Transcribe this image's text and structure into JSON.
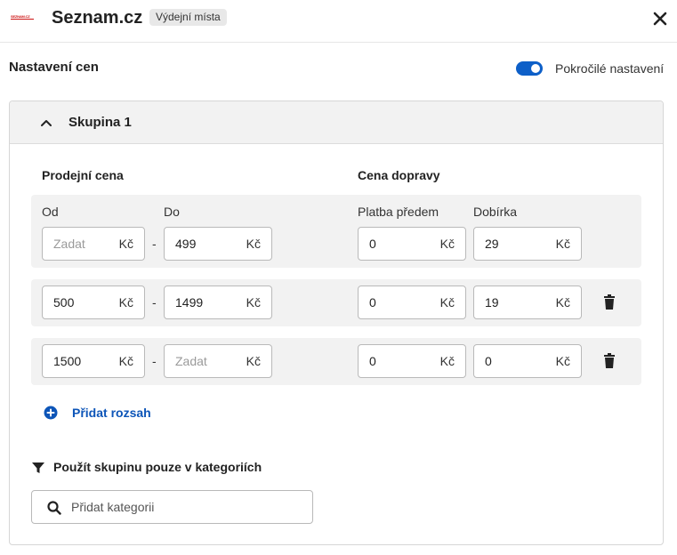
{
  "header": {
    "logo_text": "SEZNAM.CZ",
    "title": "Seznam.cz",
    "badge": "Výdejní místa",
    "close_icon": "close-icon"
  },
  "settings": {
    "title": "Nastavení cen",
    "toggle_label": "Pokročilé nastavení",
    "toggle_on": true,
    "accent_color": "#0d5fc8"
  },
  "group": {
    "title": "Skupina 1",
    "expanded": true,
    "sale_price_label": "Prodejní cena",
    "shipping_label": "Cena dopravy",
    "from_label": "Od",
    "to_label": "Do",
    "prepay_label": "Platba předem",
    "cod_label": "Dobírka",
    "currency": "Kč",
    "separator": "-",
    "rows": [
      {
        "from": "",
        "from_placeholder": "Zadat",
        "to": "499",
        "to_placeholder": "",
        "prepay": "0",
        "cod": "29",
        "deletable": false
      },
      {
        "from": "500",
        "from_placeholder": "",
        "to": "1499",
        "to_placeholder": "",
        "prepay": "0",
        "cod": "19",
        "deletable": true
      },
      {
        "from": "1500",
        "from_placeholder": "",
        "to": "",
        "to_placeholder": "Zadat",
        "prepay": "0",
        "cod": "0",
        "deletable": true
      }
    ],
    "add_range": "Přidat rozsah",
    "category_filter_label": "Použít skupinu pouze v kategoriích",
    "category_placeholder": "Přidat kategorii"
  }
}
